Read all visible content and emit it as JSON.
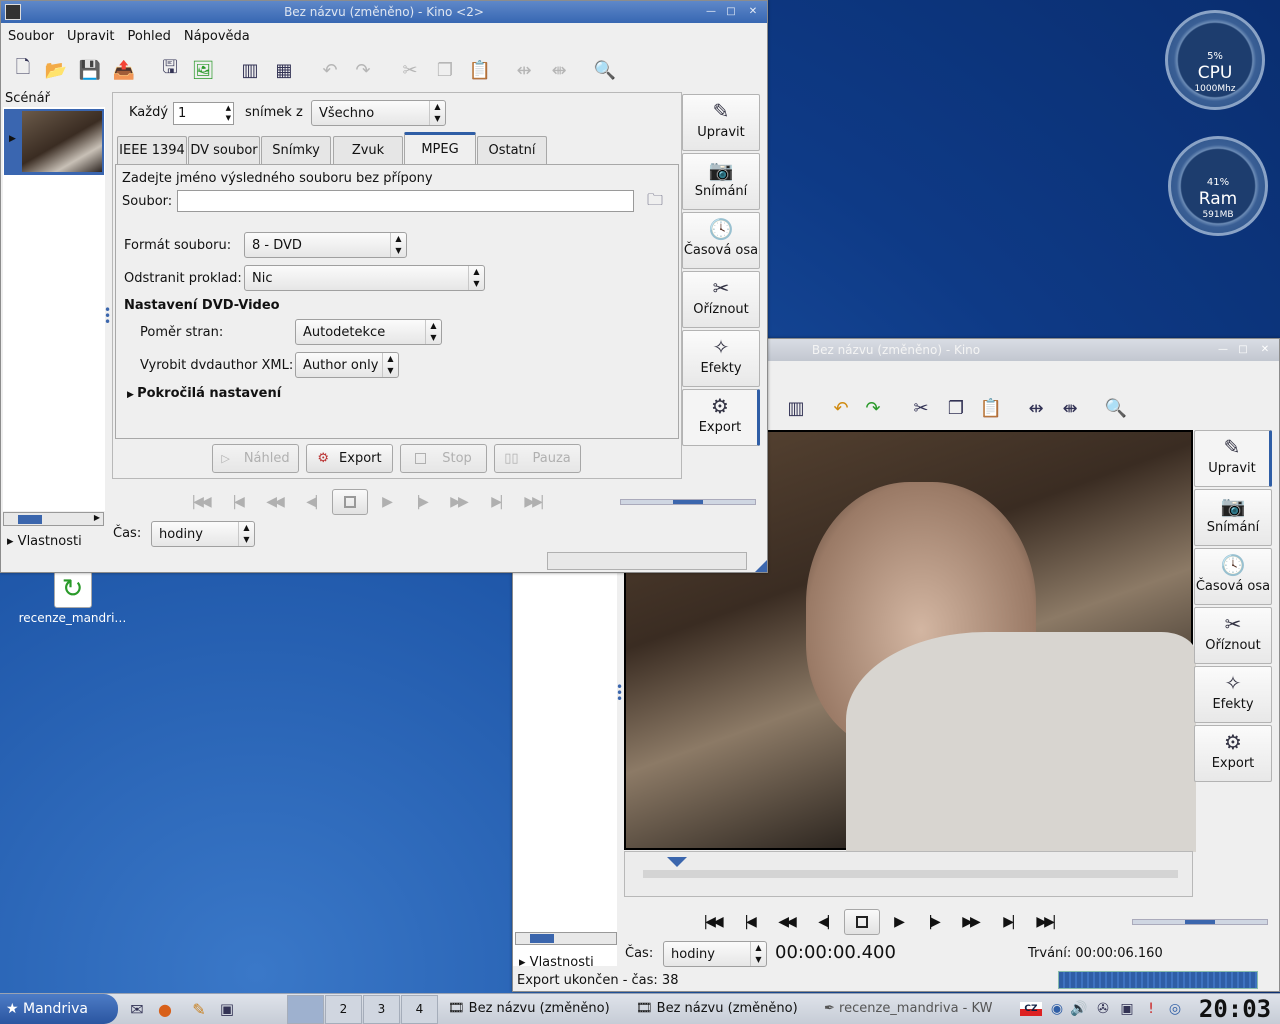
{
  "colors": {
    "accent": "#2f5ea6",
    "desktop": "#1e56a8"
  },
  "gauges": {
    "cpu": {
      "percent": "5%",
      "label": "CPU",
      "sub": "1000Mhz",
      "fraction": 0.05
    },
    "ram": {
      "percent": "41%",
      "label": "Ram",
      "sub": "591MB",
      "fraction": 0.41
    }
  },
  "desktop_icon": {
    "label": "recenze_mandri…",
    "icon": "recycle-file-icon"
  },
  "win1": {
    "title": "Bez názvu (změněno) - Kino <2>",
    "menu": [
      "Soubor",
      "Upravit",
      "Pohled",
      "Nápověda"
    ],
    "storyboard_label": "Scénář",
    "frame_label": "Každý",
    "frame_value": "1",
    "frame_of": "snímek z",
    "frame_select": "Všechno",
    "tabs": [
      "IEEE 1394",
      "DV soubor",
      "Snímky",
      "Zvuk",
      "MPEG",
      "Ostatní"
    ],
    "instruction": "Zadejte jméno výsledného souboru bez přípony",
    "file_label": "Soubor:",
    "file_value": "",
    "format_label": "Formát souboru:",
    "format_value": "8 - DVD",
    "deinterlace_label": "Odstranit proklad:",
    "deinterlace_value": "Nic",
    "dvd_heading": "Nastavení DVD-Video",
    "aspect_label": "Poměr stran:",
    "aspect_value": "Autodetekce",
    "xml_label": "Vyrobit dvdauthor XML:",
    "xml_value": "Author only",
    "advanced": "Pokročilá nastavení",
    "buttons": {
      "preview": "Náhled",
      "export": "Export",
      "stop": "Stop",
      "pause": "Pauza"
    },
    "side": [
      "Upravit",
      "Snímání",
      "Časová osa",
      "Oříznout",
      "Efekty",
      "Export"
    ],
    "properties": "Vlastnosti",
    "time_label": "Čas:",
    "time_unit": "hodiny"
  },
  "win2": {
    "title": "Bez názvu (změněno) - Kino",
    "side": [
      "Upravit",
      "Snímání",
      "Časová osa",
      "Oříznout",
      "Efekty",
      "Export"
    ],
    "properties": "Vlastnosti",
    "time_label": "Čas:",
    "time_unit": "hodiny",
    "timecode": "00:00:00.400",
    "duration": "Trvání: 00:00:06.160",
    "status": "Export ukončen - čas: 38"
  },
  "taskbar": {
    "start": "Mandriva",
    "desktops": [
      "2",
      "3",
      "4"
    ],
    "tasks": [
      "Bez názvu (změněno)",
      "Bez názvu (změněno)",
      "recenze_mandriva - KW"
    ],
    "clock": "20:03"
  }
}
